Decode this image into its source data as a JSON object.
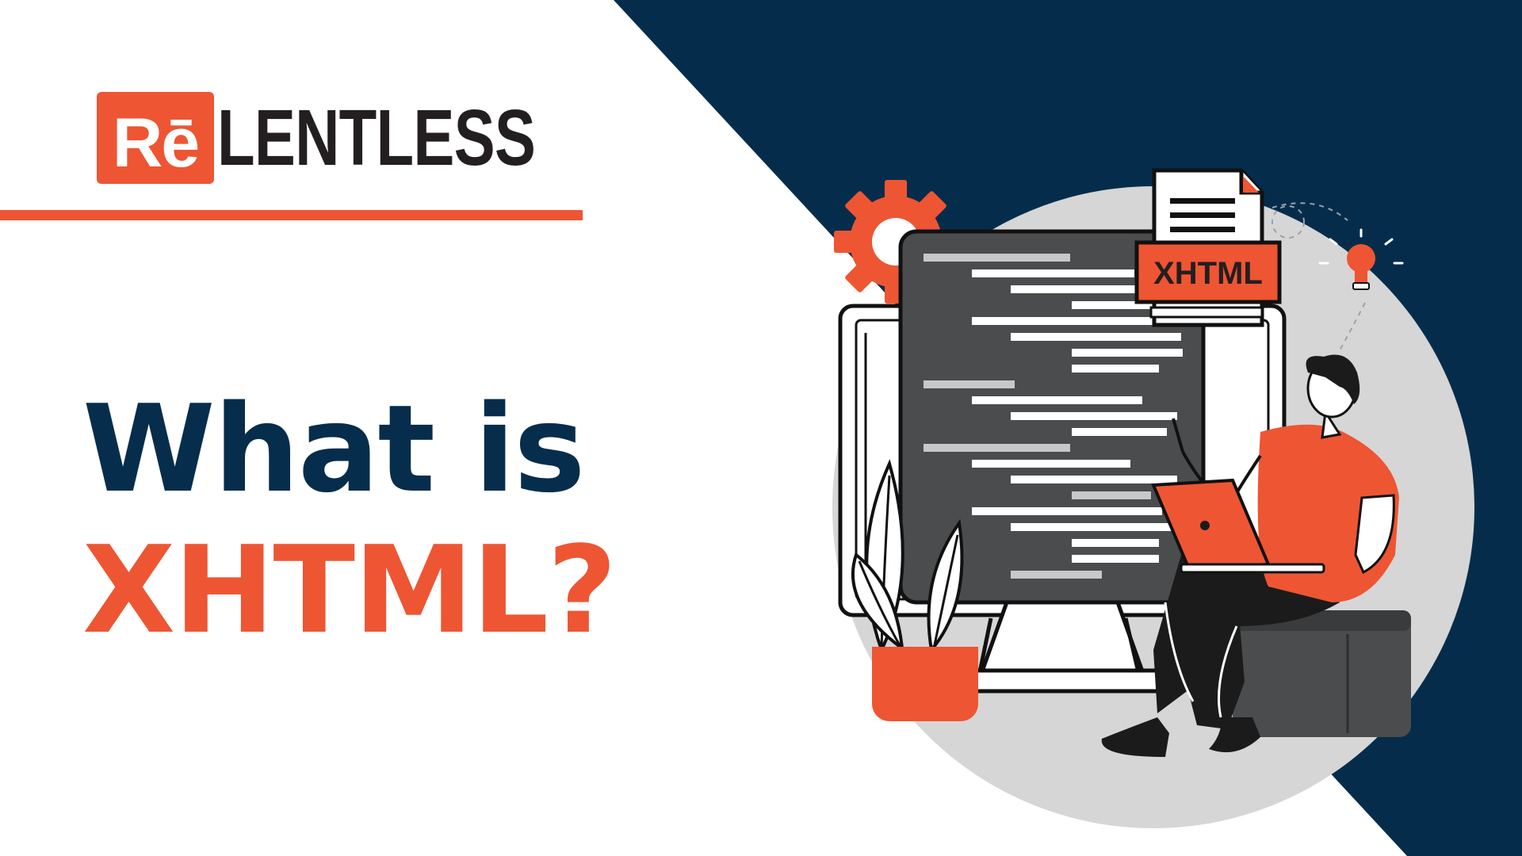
{
  "brand": {
    "badge_text": "Rē",
    "word": "LENTLESS"
  },
  "headline": {
    "line1": "What is",
    "line2": "XHTML?"
  },
  "illustration": {
    "document_tag": "XHTML"
  },
  "colors": {
    "accent": "#ee5533",
    "navy": "#052d4b",
    "dark_text": "#231f20",
    "screen": "#4a4c4d",
    "circle": "#d6d6d6"
  }
}
